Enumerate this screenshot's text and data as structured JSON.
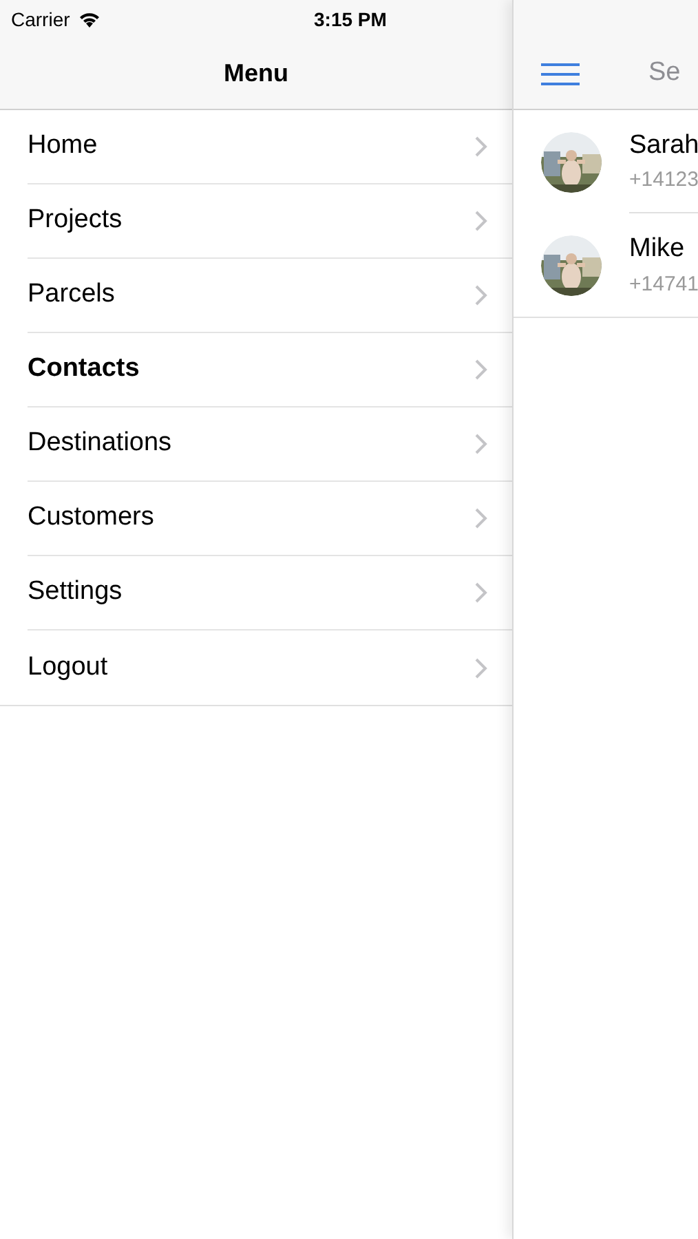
{
  "status_bar": {
    "carrier": "Carrier",
    "time": "3:15 PM"
  },
  "menu": {
    "title": "Menu",
    "items": [
      {
        "label": "Home",
        "selected": false
      },
      {
        "label": "Projects",
        "selected": false
      },
      {
        "label": "Parcels",
        "selected": false
      },
      {
        "label": "Contacts",
        "selected": true
      },
      {
        "label": "Destinations",
        "selected": false
      },
      {
        "label": "Customers",
        "selected": false
      },
      {
        "label": "Settings",
        "selected": false
      },
      {
        "label": "Logout",
        "selected": false
      }
    ]
  },
  "main": {
    "title": "Se",
    "contacts": [
      {
        "name": "Sarah",
        "phone": "+14123"
      },
      {
        "name": "Mike",
        "phone": "+14741"
      }
    ]
  }
}
